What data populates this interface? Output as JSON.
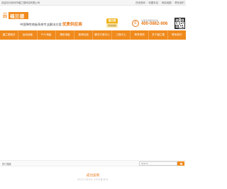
{
  "topbar": {
    "welcome": "欢迎访问深圳市福兰德科技有限公司",
    "links": [
      "在线咨询",
      "收藏本站",
      "网站地图",
      "联系我们"
    ]
  },
  "header": {
    "logo_mark": "云",
    "logo_text": "福兰德",
    "slogan_text": "中国弹性地板系统专业解决方案",
    "slogan_highlight": "优质供应商",
    "badge_top": "福兰德",
    "badge_bottom": "值得信赖",
    "hotline_label": "全国咨询服务热线",
    "hotline_number": "400-0862-906",
    "phone_icon": "phone-icon",
    "brand_color": "#f08a1c"
  },
  "nav": {
    "items": [
      "福兰德首页",
      "运动地板",
      "PVC地板",
      "橡胶地板",
      "新闻动态",
      "解决方案中心",
      "工程中心",
      "荣誉资质",
      "关于福兰德",
      "联系我们"
    ]
  },
  "search": {
    "hot_label": "热门搜索",
    "placeholder": "Search",
    "search_icon": "search-icon"
  },
  "section": {
    "title": "成功案例",
    "subtitle": "SUCCESS STORIES"
  }
}
